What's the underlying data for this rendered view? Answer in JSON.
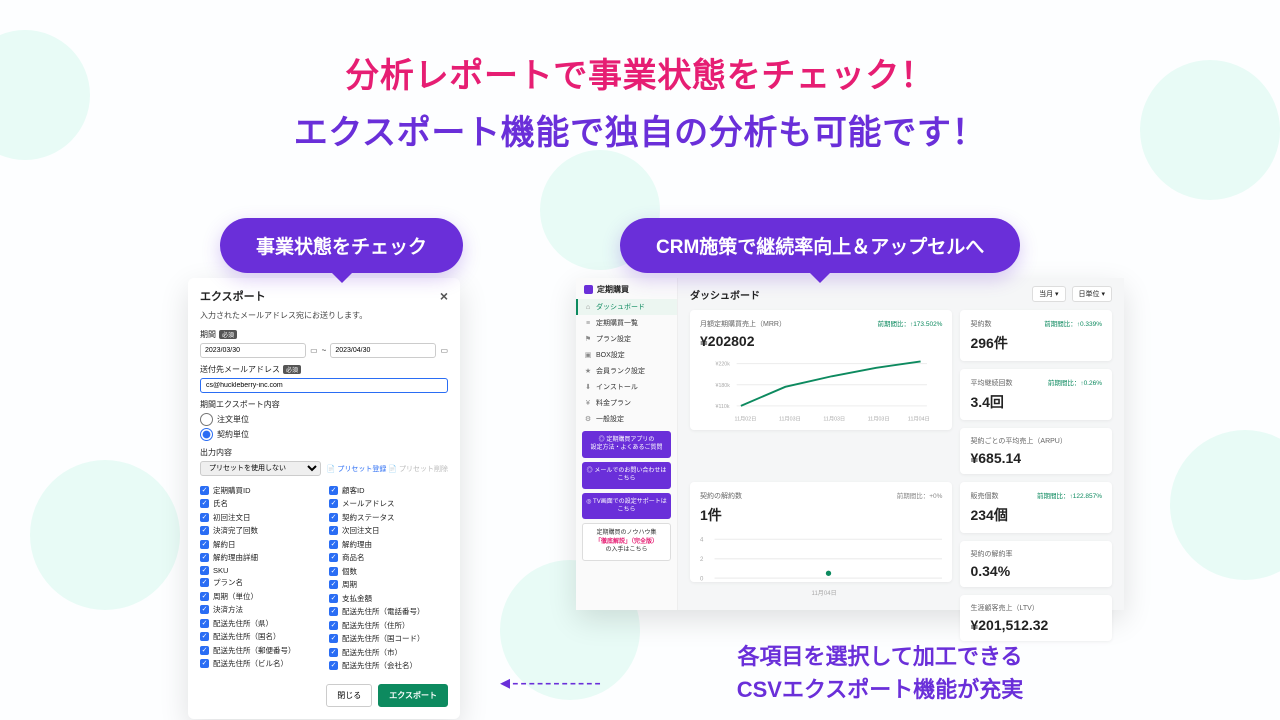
{
  "headline": {
    "l1": "分析レポートで事業状態をチェック！",
    "l2": "エクスポート機能で独自の分析も可能です！"
  },
  "pills": {
    "left": "事業状態をチェック",
    "right": "CRM施策で継続率向上＆アップセルへ"
  },
  "export_modal": {
    "title": "エクスポート",
    "subtitle": "入力されたメールアドレス宛にお送りします。",
    "required_badge": "必須",
    "period_label": "期間",
    "date_from": "2023/03/30",
    "date_sep": "~",
    "date_to": "2023/04/30",
    "email_label": "送付先メールアドレス",
    "email_value": "cs@huckleberry-inc.com",
    "section_period": "期間エクスポート内容",
    "radio1": "注文単位",
    "radio2": "契約単位",
    "section_output": "出力内容",
    "select_placeholder": "プリセットを使用しない",
    "preset_reg": "プリセット登録",
    "preset_del": "プリセット削除",
    "checks_left": [
      "定期購買ID",
      "氏名",
      "初回注文日",
      "決済完了回数",
      "解約日",
      "解約理由詳細",
      "SKU",
      "プラン名",
      "周期（単位）",
      "決済方法",
      "配送先住所（県）",
      "配送先住所（国名）",
      "配送先住所（郵便番号）",
      "配送先住所（ビル名）"
    ],
    "checks_right": [
      "顧客ID",
      "メールアドレス",
      "契約ステータス",
      "次回注文日",
      "解約理由",
      "商品名",
      "個数",
      "周期",
      "支払金額",
      "配送先住所（電話番号）",
      "配送先住所（住所）",
      "配送先住所（国コード）",
      "配送先住所（市）",
      "配送先住所（会社名）"
    ],
    "btn_cancel": "閉じる",
    "btn_submit": "エクスポート"
  },
  "dashboard": {
    "brand": "定期購買",
    "nav": [
      "ダッシュボード",
      "定期購買一覧",
      "プラン設定",
      "BOX設定",
      "会員ランク設定",
      "インストール",
      "料金プラン",
      "一般設定"
    ],
    "help": [
      {
        "cls": "p",
        "l1": "定期購買アプリの",
        "l2": "設定方法・よくあるご質問"
      },
      {
        "cls": "p",
        "l1": "メールでのお問い合わせは",
        "l2": "こちら"
      },
      {
        "cls": "p",
        "l1": "TV画面での設定サポートは",
        "l2": "こちら"
      }
    ],
    "help_white": {
      "a": "定期購買のノウハウ集",
      "b": "「徹底解説」",
      "c": "（完全版）",
      "d": "の入手はこちら"
    },
    "title": "ダッシュボード",
    "filter1": "当月 ▾",
    "filter2": "日単位 ▾",
    "mrr": {
      "ttl": "月額定期購買売上（MRR）",
      "val": "¥202802",
      "yoy": "前期間比：↑173.502%"
    },
    "mrr_ticks": [
      "11月02日",
      "11月03日",
      "11月03日",
      "11月03日",
      "11月04日"
    ],
    "mrr_y": [
      "¥220k",
      "¥180k",
      "¥110k"
    ],
    "stats": [
      {
        "ttl": "契約数",
        "val": "296件",
        "yoy": "前期間比：↑0.339%"
      },
      {
        "ttl": "平均継続回数",
        "val": "3.4回",
        "yoy": "前期間比：↑0.26%"
      },
      {
        "ttl": "契約ごとの平均売上（ARPU）",
        "val": "¥685.14",
        "yoy": ""
      }
    ],
    "churn": {
      "ttl": "契約の解約数",
      "val": "1件",
      "yoy": "前期間比：+0%"
    },
    "churn_ticks": [
      "11月04日"
    ],
    "stats2": [
      {
        "ttl": "販売個数",
        "val": "234個",
        "yoy": "前期間比：↑122.857%"
      },
      {
        "ttl": "契約の解約率",
        "val": "0.34%",
        "yoy": ""
      },
      {
        "ttl": "生涯顧客売上（LTV）",
        "val": "¥201,512.32",
        "yoy": ""
      }
    ]
  },
  "callout": {
    "l1": "各項目を選択して加工できる",
    "l2": "CSVエクスポート機能が充実"
  },
  "chart_data": [
    {
      "type": "line",
      "title": "月額定期購買売上（MRR）",
      "x": [
        "11月02日",
        "11月03日",
        "11月03日",
        "11月03日",
        "11月04日"
      ],
      "values": [
        110000,
        155000,
        180000,
        200000,
        218000
      ],
      "ylabel": "¥",
      "ylim": [
        110000,
        220000
      ]
    },
    {
      "type": "scatter",
      "title": "契約の解約数",
      "x": [
        "11月04日"
      ],
      "values": [
        1
      ],
      "ylim": [
        0,
        4
      ]
    }
  ]
}
